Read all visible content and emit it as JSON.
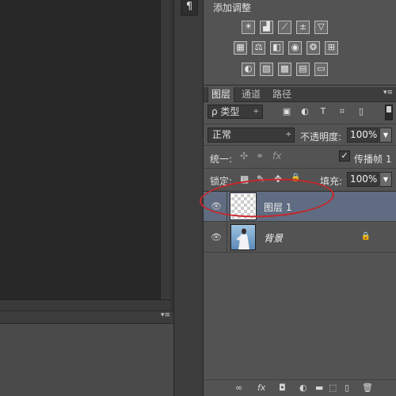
{
  "dock": {
    "paragraph_icon": "¶"
  },
  "adjustments": {
    "title": "添加调整",
    "rows": [
      [
        {
          "name": "brightness-contrast-icon",
          "glyph": "☀"
        },
        {
          "name": "levels-icon",
          "glyph": "▟"
        },
        {
          "name": "curves-icon",
          "glyph": "⟋"
        },
        {
          "name": "exposure-icon",
          "glyph": "±"
        },
        {
          "name": "vibrance-icon",
          "glyph": "▽"
        }
      ],
      [
        {
          "name": "hue-saturation-icon",
          "glyph": "▦"
        },
        {
          "name": "color-balance-icon",
          "glyph": "⚖"
        },
        {
          "name": "black-white-icon",
          "glyph": "◧"
        },
        {
          "name": "photo-filter-icon",
          "glyph": "◉"
        },
        {
          "name": "channel-mixer-icon",
          "glyph": "❂"
        },
        {
          "name": "color-lookup-icon",
          "glyph": "⊞"
        }
      ],
      [
        {
          "name": "invert-icon",
          "glyph": "◐"
        },
        {
          "name": "posterize-icon",
          "glyph": "▨"
        },
        {
          "name": "threshold-icon",
          "glyph": "▩"
        },
        {
          "name": "selective-color-icon",
          "glyph": "▤"
        },
        {
          "name": "gradient-map-icon",
          "glyph": "▭"
        }
      ]
    ]
  },
  "layers_panel": {
    "tabs": [
      "图层",
      "通道",
      "路径"
    ],
    "menu_icon": "▾≡",
    "filter": {
      "value": "ρ 类型",
      "caret": "÷"
    },
    "filter_icons": [
      "▣",
      "◐",
      "T",
      "⌗",
      "▯"
    ],
    "blend_mode": {
      "value": "正常",
      "caret": "÷"
    },
    "opacity": {
      "label": "不透明度:",
      "value": "100%"
    },
    "unify": {
      "label": "统一:",
      "icons": [
        "✣",
        "⚭",
        "fx"
      ]
    },
    "propagate": {
      "checked": "✓",
      "label": "传播帧 1"
    },
    "lock": {
      "label": "锁定:",
      "icons": [
        "▩",
        "✎",
        "✥",
        "🔒"
      ]
    },
    "fill": {
      "label": "填充:",
      "value": "100%"
    },
    "layers": [
      {
        "name": "图层 1",
        "visible_icon": "👁",
        "selected": true
      },
      {
        "name": "背景",
        "visible_icon": "👁",
        "locked_icon": "🔒"
      }
    ],
    "bottom_icons": [
      "∞",
      "fx",
      "◘",
      "◐",
      "▬",
      "⬚",
      "▯",
      "🗑"
    ]
  },
  "bottom_left_panel": {
    "menu_icon": "▾≡"
  }
}
